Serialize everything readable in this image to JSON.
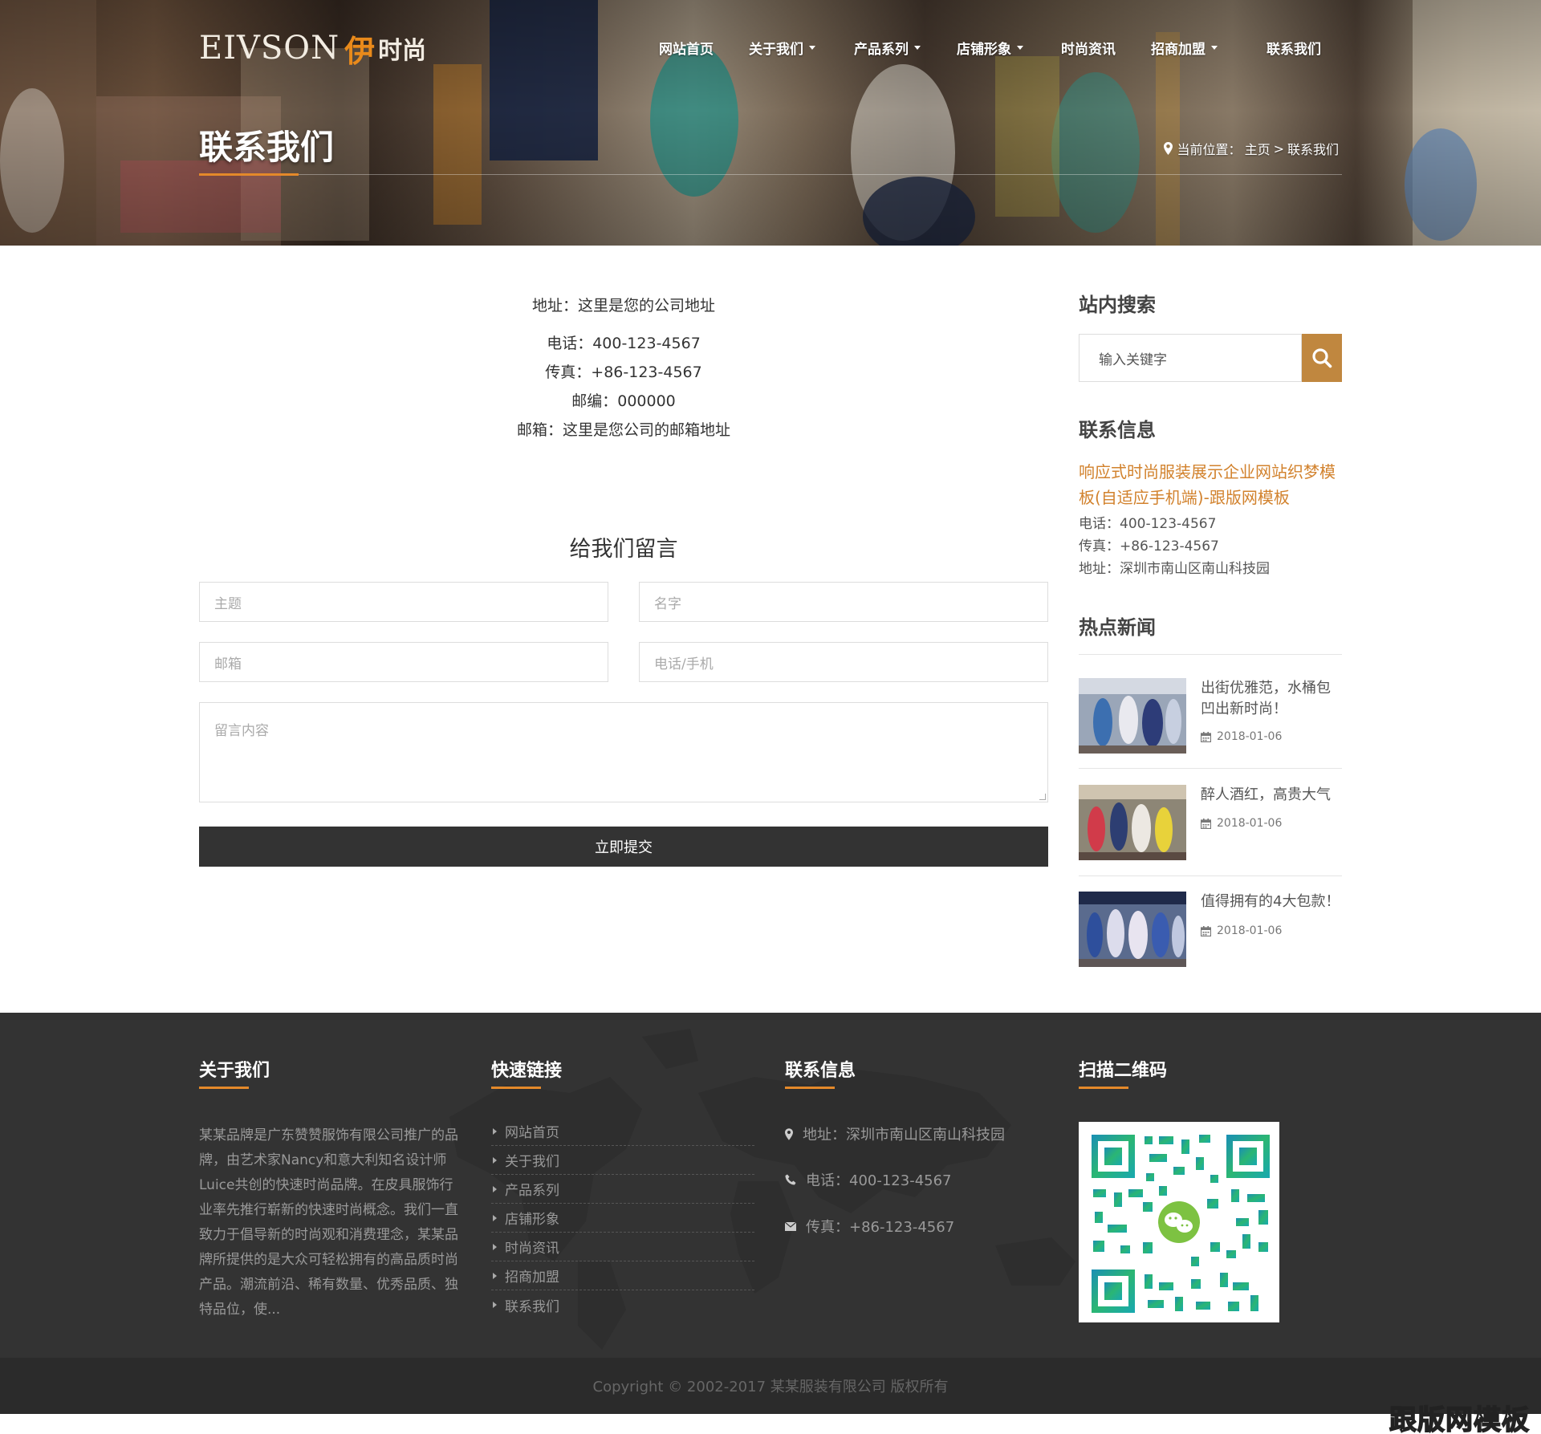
{
  "header": {
    "logo_en": "EIVSON",
    "logo_cn_1": "伊",
    "logo_cn_2": "时尚",
    "nav": [
      {
        "label": "网站首页",
        "dropdown": false
      },
      {
        "label": "关于我们",
        "dropdown": true
      },
      {
        "label": "产品系列",
        "dropdown": true
      },
      {
        "label": "店铺形象",
        "dropdown": true
      },
      {
        "label": "时尚资讯",
        "dropdown": false
      },
      {
        "label": "招商加盟",
        "dropdown": true
      },
      {
        "label": "联系我们",
        "dropdown": false
      }
    ],
    "page_title": "联系我们",
    "breadcrumb": {
      "prefix": "当前位置：",
      "home": "主页",
      "sep": ">",
      "current": "联系我们"
    }
  },
  "contact": {
    "address": "地址：这里是您的公司地址",
    "phone": "电话：400-123-4567",
    "fax": "传真：+86-123-4567",
    "zip": "邮编：000000",
    "email": "邮箱：这里是您公司的邮箱地址"
  },
  "form": {
    "title": "给我们留言",
    "subject_placeholder": "主题",
    "name_placeholder": "名字",
    "email_placeholder": "邮箱",
    "phone_placeholder": "电话/手机",
    "message_placeholder": "留言内容",
    "submit_label": "立即提交"
  },
  "sidebar": {
    "search_heading": "站内搜索",
    "search_placeholder": "输入关键字",
    "contact_heading": "联系信息",
    "site_link": "响应式时尚服装展示企业网站织梦模板(自适应手机端)-跟版网模板",
    "phone": "电话：400-123-4567",
    "fax": "传真：+86-123-4567",
    "address": "地址：深圳市南山区南山科技园",
    "news_heading": "热点新闻",
    "news": [
      {
        "title": "出街优雅范，水桶包凹出新时尚！",
        "date": "2018-01-06"
      },
      {
        "title": "醉人酒红，高贵大气",
        "date": "2018-01-06"
      },
      {
        "title": "值得拥有的4大包款！",
        "date": "2018-01-06"
      }
    ]
  },
  "footer": {
    "about_heading": "关于我们",
    "about_text": "某某品牌是广东赞赞服饰有限公司推广的品牌，由艺术家Nancy和意大利知名设计师Luice共创的快速时尚品牌。在皮具服饰行业率先推行崭新的快速时尚概念。我们一直致力于倡导新的时尚观和消费理念，某某品牌所提供的是大众可轻松拥有的高品质时尚产品。潮流前沿、稀有数量、优秀品质、独特品位，使...",
    "links_heading": "快速链接",
    "links": [
      "网站首页",
      "关于我们",
      "产品系列",
      "店铺形象",
      "时尚资讯",
      "招商加盟",
      "联系我们"
    ],
    "contact_heading": "联系信息",
    "contact_address": "地址：深圳市南山区南山科技园",
    "contact_phone": "电话：400-123-4567",
    "contact_fax": "传真：+86-123-4567",
    "qr_heading": "扫描二维码",
    "copyright": "Copyright © 2002-2017 某某服装有限公司 版权所有"
  },
  "watermark": "跟版网模板",
  "colors": {
    "accent": "#e4892a",
    "link": "#d2822d",
    "search_button": "#c0873f",
    "footer_bg": "#333333",
    "copyright_bg": "#2b2b2b",
    "submit_bg": "#333333"
  }
}
